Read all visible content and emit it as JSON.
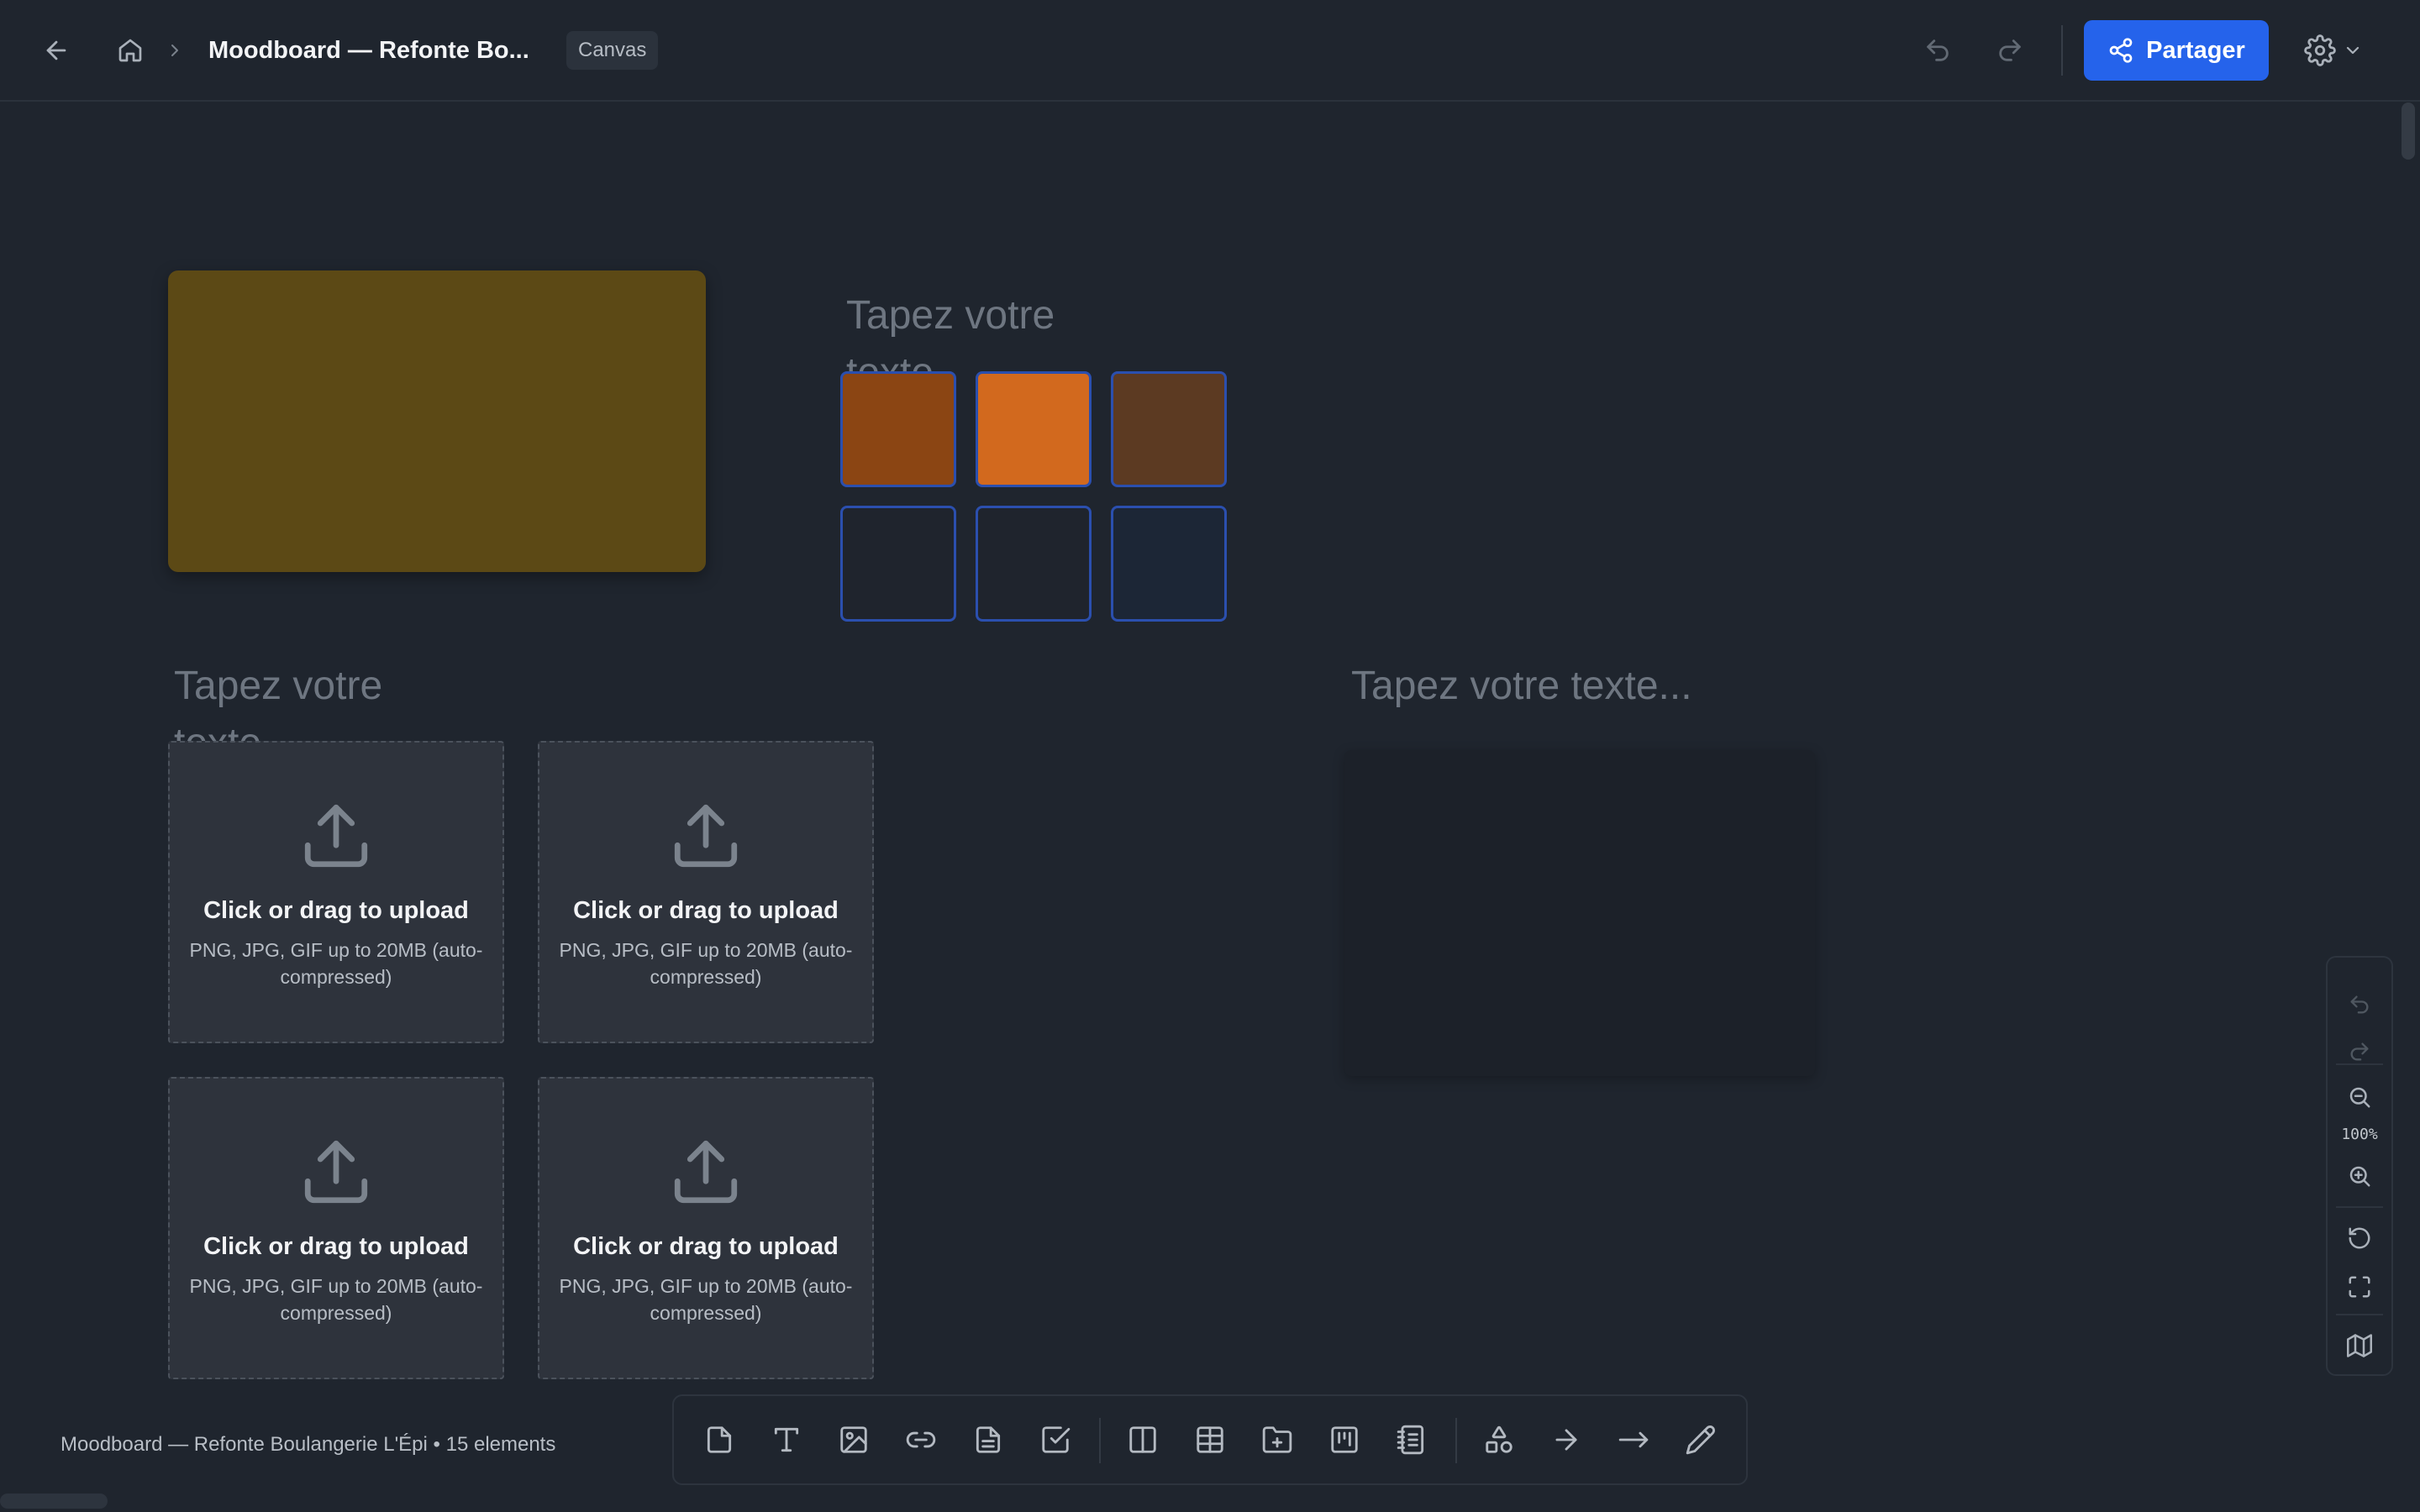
{
  "header": {
    "title": "Moodboard — Refonte Bo...",
    "badge": "Canvas",
    "share_label": "Partager"
  },
  "canvas": {
    "sticky_color": "#5c4915",
    "text_placeholder_1": "Tapez votre texte...",
    "text_placeholder_2": "Tapez votre texte...",
    "text_placeholder_3": "Tapez votre texte...",
    "swatches": [
      "#8b4513",
      "#d2691e",
      "#5c3a22",
      "#1f242d",
      "#1f242d",
      "#1c2636"
    ],
    "uploads": [
      {
        "title": "Click or drag to upload",
        "subtitle": "PNG, JPG, GIF up to 20MB (auto-compressed)"
      },
      {
        "title": "Click or drag to upload",
        "subtitle": "PNG, JPG, GIF up to 20MB (auto-compressed)"
      },
      {
        "title": "Click or drag to upload",
        "subtitle": "PNG, JPG, GIF up to 20MB (auto-compressed)"
      },
      {
        "title": "Click or drag to upload",
        "subtitle": "PNG, JPG, GIF up to 20MB (auto-compressed)"
      }
    ]
  },
  "zoom": {
    "level": "100%"
  },
  "footer": {
    "info": "Moodboard — Refonte Boulangerie L'Épi • 15 elements"
  },
  "toolbar": {
    "tools": [
      "note",
      "text",
      "image",
      "link",
      "document",
      "checklist",
      "column",
      "table",
      "folder",
      "board",
      "list",
      "shapes",
      "arrow",
      "line",
      "pen"
    ]
  },
  "colors": {
    "accent": "#2563eb",
    "background": "#1f252e"
  }
}
